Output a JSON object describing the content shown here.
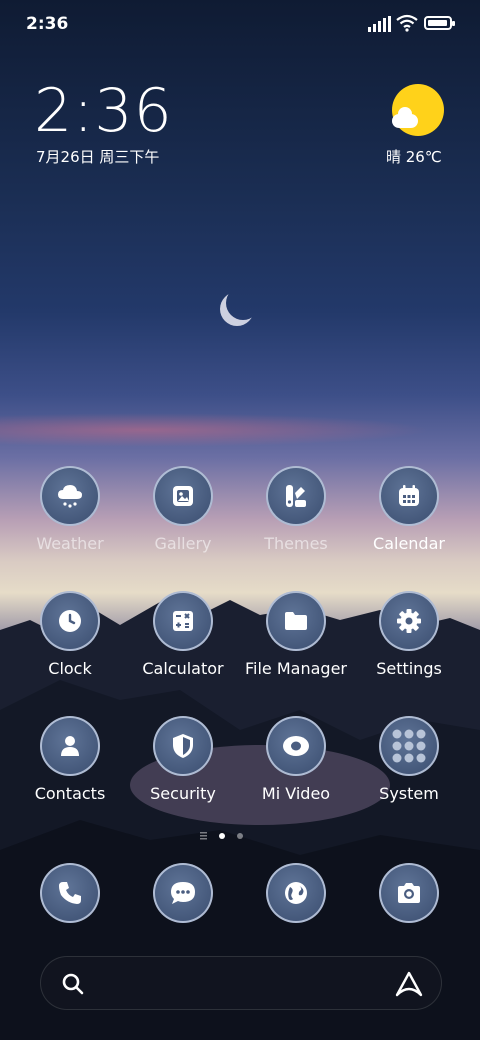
{
  "status_bar": {
    "time": "2:36"
  },
  "clock_widget": {
    "time": "2:36",
    "date": "7月26日 周三下午"
  },
  "weather_widget": {
    "text": "晴 26℃",
    "icon": "partly-sunny-icon"
  },
  "apps": [
    {
      "label": "Weather",
      "icon": "weather-icon"
    },
    {
      "label": "Gallery",
      "icon": "gallery-icon"
    },
    {
      "label": "Themes",
      "icon": "themes-icon"
    },
    {
      "label": "Calendar",
      "icon": "calendar-icon"
    },
    {
      "label": "Clock",
      "icon": "clock-icon"
    },
    {
      "label": "Calculator",
      "icon": "calculator-icon"
    },
    {
      "label": "File Manager",
      "icon": "folder-icon"
    },
    {
      "label": "Settings",
      "icon": "gear-icon"
    },
    {
      "label": "Contacts",
      "icon": "contacts-icon"
    },
    {
      "label": "Security",
      "icon": "shield-icon"
    },
    {
      "label": "Mi Video",
      "icon": "video-icon"
    },
    {
      "label": "System",
      "icon": "folder-grid-icon"
    }
  ],
  "page_indicator": {
    "pages": 2,
    "current": 1
  },
  "dock": [
    {
      "icon": "phone-icon"
    },
    {
      "icon": "message-icon"
    },
    {
      "icon": "browser-icon"
    },
    {
      "icon": "camera-icon"
    }
  ],
  "search_bar": {
    "icon": "search-icon",
    "assistant_icon": "assistant-icon"
  }
}
